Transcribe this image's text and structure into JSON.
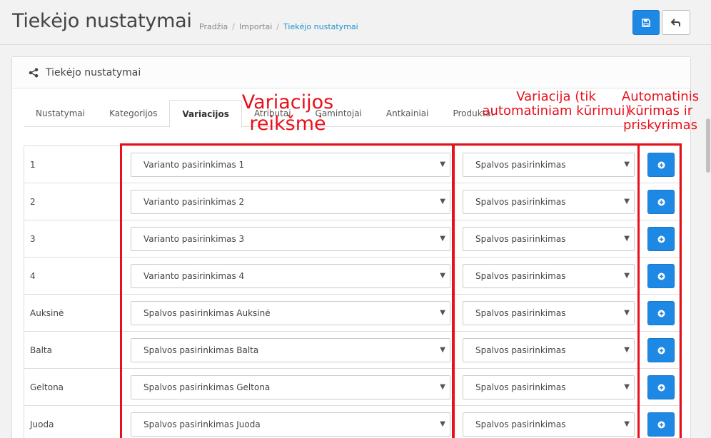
{
  "header": {
    "title": "Tiekėjo nustatymai",
    "breadcrumb": [
      "Pradžia",
      "Importai",
      "Tiekėjo nustatymai"
    ]
  },
  "panel": {
    "title": "Tiekėjo nustatymai",
    "tabs": [
      "Nustatymai",
      "Kategorijos",
      "Variacijos",
      "Atributai",
      "Gamintojai",
      "Antkainiai",
      "Produktai"
    ],
    "active_tab": "Variacijos"
  },
  "rows": [
    {
      "label": "1",
      "value": "Varianto pasirinkimas 1",
      "variation": "Spalvos pasirinkimas"
    },
    {
      "label": "2",
      "value": "Varianto pasirinkimas 2",
      "variation": "Spalvos pasirinkimas"
    },
    {
      "label": "3",
      "value": "Varianto pasirinkimas 3",
      "variation": "Spalvos pasirinkimas"
    },
    {
      "label": "4",
      "value": "Varianto pasirinkimas 4",
      "variation": "Spalvos pasirinkimas"
    },
    {
      "label": "Auksinė",
      "value": "Spalvos pasirinkimas Auksinė",
      "variation": "Spalvos pasirinkimas"
    },
    {
      "label": "Balta",
      "value": "Spalvos pasirinkimas Balta",
      "variation": "Spalvos pasirinkimas"
    },
    {
      "label": "Geltona",
      "value": "Spalvos pasirinkimas Geltona",
      "variation": "Spalvos pasirinkimas"
    },
    {
      "label": "Juoda",
      "value": "Spalvos pasirinkimas Juoda",
      "variation": "Spalvos pasirinkimas"
    }
  ],
  "annotations": {
    "value_col": "Variacijos reikšmė",
    "variation_col": "Variacija (tik automatiniam kūrimui)",
    "auto_col": "Automatinis kūrimas ir priskyrimas"
  },
  "colors": {
    "primary": "#1e88e5",
    "annotation": "#e8101a",
    "link": "#1e91cf"
  },
  "icons": {
    "save": "floppy-disk-icon",
    "back": "reply-arrow-icon",
    "panel": "share-nodes-icon",
    "add": "plus-circle-icon",
    "dropdown": "caret-down-icon"
  }
}
